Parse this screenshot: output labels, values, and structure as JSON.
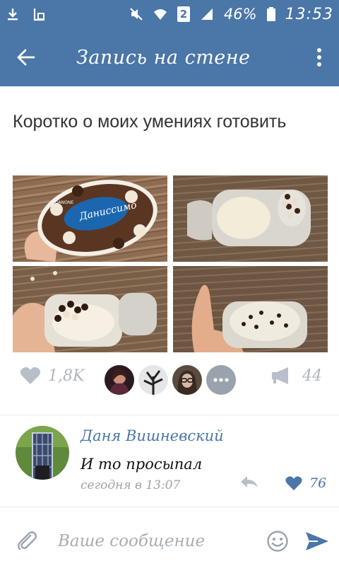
{
  "status_bar": {
    "battery_percent": "46%",
    "time": "13:53",
    "sim_slot": "2",
    "icons": [
      "download-icon",
      "photo-icon",
      "mute-icon",
      "wifi-icon",
      "sim-icon",
      "signal-icon",
      "battery-icon"
    ]
  },
  "toolbar": {
    "title": "Запись на стене",
    "back_icon": "arrow-left-icon",
    "menu_icon": "more-vertical-icon"
  },
  "post": {
    "text": "Коротко о моих умениях готовить",
    "photos": [
      {
        "name": "yogurt-package-photo"
      },
      {
        "name": "open-yogurt-cup-photo"
      },
      {
        "name": "spilled-chocolate-balls-photo"
      },
      {
        "name": "mixed-yogurt-photo"
      }
    ],
    "package_brand": "Даниссимо",
    "package_label": "DANONE",
    "likes_count": "1,8K",
    "shares_count": "44",
    "colors": {
      "accent": "#4a76a8",
      "inactive": "#b0b7c0"
    }
  },
  "comment": {
    "author": "Даня Вишневский",
    "text": "И то просыпал",
    "time": "сегодня в 13:07",
    "likes_count": "76"
  },
  "composer": {
    "placeholder": "Ваше сообщение"
  }
}
